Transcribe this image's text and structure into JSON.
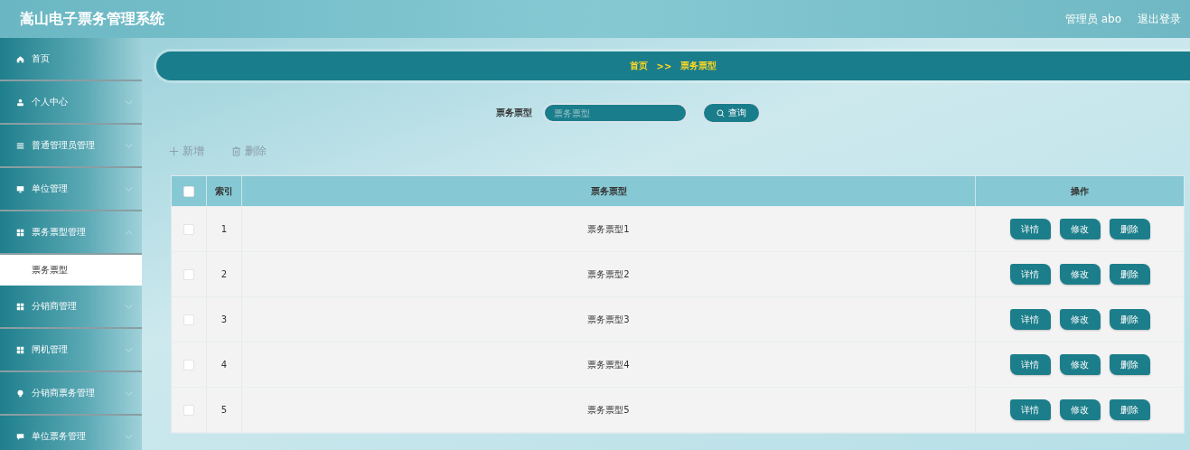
{
  "header": {
    "title": "嵩山电子票务管理系统",
    "user": "管理员 abo",
    "logout": "退出登录"
  },
  "sidebar": {
    "items": [
      {
        "label": "首页",
        "kind": "link",
        "selected": false
      },
      {
        "label": "个人中心",
        "kind": "group",
        "expanded": false,
        "selected": false
      },
      {
        "label": "普通管理员管理",
        "kind": "group",
        "expanded": false,
        "selected": false
      },
      {
        "label": "单位管理",
        "kind": "group",
        "expanded": false,
        "selected": false
      },
      {
        "label": "票务票型管理",
        "kind": "group",
        "expanded": true,
        "selected": false,
        "children": [
          {
            "label": "票务票型",
            "selected": true
          }
        ]
      },
      {
        "label": "分销商管理",
        "kind": "group",
        "expanded": false,
        "selected": false
      },
      {
        "label": "闸机管理",
        "kind": "group",
        "expanded": false,
        "selected": false
      },
      {
        "label": "分销商票务管理",
        "kind": "group",
        "expanded": false,
        "selected": false
      },
      {
        "label": "单位票务管理",
        "kind": "group",
        "expanded": false,
        "selected": false
      }
    ]
  },
  "breadcrumb": {
    "home": "首页",
    "separator": ">>",
    "current": "票务票型"
  },
  "search": {
    "label": "票务票型",
    "placeholder": "票务票型",
    "button": "查询"
  },
  "actions": {
    "add": "新增",
    "delete": "删除"
  },
  "table": {
    "header_checked": false,
    "columns": [
      "索引",
      "票务票型",
      "操作"
    ],
    "rows": [
      {
        "checked": false,
        "index": "1",
        "type": "票务票型1",
        "buttons": [
          "详情",
          "修改",
          "删除"
        ]
      },
      {
        "checked": false,
        "index": "2",
        "type": "票务票型2",
        "buttons": [
          "详情",
          "修改",
          "删除"
        ]
      },
      {
        "checked": false,
        "index": "3",
        "type": "票务票型3",
        "buttons": [
          "详情",
          "修改",
          "删除"
        ]
      },
      {
        "checked": false,
        "index": "4",
        "type": "票务票型4",
        "buttons": [
          "详情",
          "修改",
          "删除"
        ]
      },
      {
        "checked": false,
        "index": "5",
        "type": "票务票型5",
        "buttons": [
          "详情",
          "修改",
          "删除"
        ]
      }
    ]
  }
}
